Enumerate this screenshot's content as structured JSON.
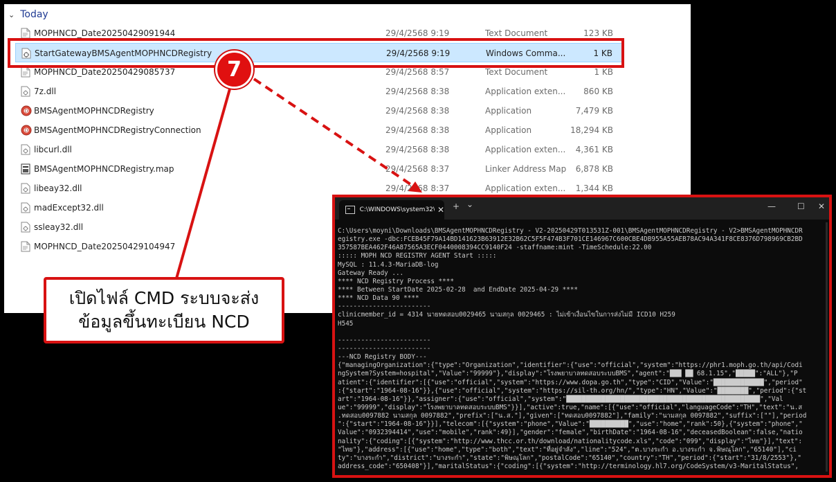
{
  "explorer": {
    "group_label": "Today",
    "files": [
      {
        "name": "MOPHNCD_Date20250429091944",
        "date": "29/4/2568 9:19",
        "type": "Text Document",
        "size": "123 KB",
        "icon": "text-file-icon",
        "selected": false
      },
      {
        "name": "StartGatewayBMSAgentMOPHNCDRegistry",
        "date": "29/4/2568 9:19",
        "type": "Windows Comma...",
        "size": "1 KB",
        "icon": "batch-file-icon",
        "selected": true
      },
      {
        "name": "MOPHNCD_Date20250429085737",
        "date": "29/4/2568 8:57",
        "type": "Text Document",
        "size": "1 KB",
        "icon": "text-file-icon",
        "selected": false
      },
      {
        "name": "7z.dll",
        "date": "29/4/2568 8:38",
        "type": "Application exten...",
        "size": "860 KB",
        "icon": "dll-file-icon",
        "selected": false
      },
      {
        "name": "BMSAgentMOPHNCDRegistry",
        "date": "29/4/2568 8:38",
        "type": "Application",
        "size": "7,479 KB",
        "icon": "app-icon",
        "selected": false
      },
      {
        "name": "BMSAgentMOPHNCDRegistryConnection",
        "date": "29/4/2568 8:38",
        "type": "Application",
        "size": "18,294 KB",
        "icon": "app-icon",
        "selected": false
      },
      {
        "name": "libcurl.dll",
        "date": "29/4/2568 8:38",
        "type": "Application exten...",
        "size": "4,361 KB",
        "icon": "dll-file-icon",
        "selected": false
      },
      {
        "name": "BMSAgentMOPHNCDRegistry.map",
        "date": "29/4/2568 8:37",
        "type": "Linker Address Map",
        "size": "6,878 KB",
        "icon": "map-file-icon",
        "selected": false
      },
      {
        "name": "libeay32.dll",
        "date": "29/4/2568 8:37",
        "type": "Application exten...",
        "size": "1,344 KB",
        "icon": "dll-file-icon",
        "selected": false
      },
      {
        "name": "madExcept32.dll",
        "date": "",
        "type": "",
        "size": "",
        "icon": "dll-file-icon",
        "selected": false
      },
      {
        "name": "ssleay32.dll",
        "date": "",
        "type": "",
        "size": "",
        "icon": "dll-file-icon",
        "selected": false
      },
      {
        "name": "MOPHNCD_Date20250429104947",
        "date": "",
        "type": "",
        "size": "",
        "icon": "text-file-icon",
        "selected": false
      }
    ]
  },
  "annotation": {
    "step_number": "7",
    "callout_line1": "เปิดไฟล์ CMD ระบบจะส่ง",
    "callout_line2": "ข้อมูลขึ้นทะเบียน NCD",
    "accent_color": "#d81212"
  },
  "cmd": {
    "tab_title": "C:\\WINDOWS\\system32\\cmd.",
    "new_tab": "+",
    "dropdown": "⌄",
    "minimize": "—",
    "maximize": "☐",
    "close": "✕",
    "lines": [
      "C:\\Users\\moyni\\Downloads\\BMSAgentMOPHNCDRegistry - V2-20250429T013531Z-001\\BMSAgentMOPHNCDRegistry - V2>BMSAgentMOPHNCDR",
      "egistry.exe -dbc:FCEB45F79A14BD141623B63912E32B62C5F5F474B3F701CE146967C600CBE4DB955A55AEB78AC94A341F8CE8376D798969CB2BD",
      "357587BEA462F46A87565A3ECF0440008394CC9140F24 -staffname:mint -TimeSchedule:22.00",
      "::::: MOPH NCD REGISTRY AGENT Start :::::",
      "MySQL : 11.4.3-MariaDB-log",
      "Gateway Ready ...",
      "**** NCD Registry Process ****",
      "**** Between StartDate 2025-02-28  and EndDate 2025-04-29 ****",
      "**** NCD Data 90 ****",
      "------------------------",
      "clinicmember_id = 4314 นายทดสอบ0029465 นามสกุล 0029465 : ไม่เข้าเงื่อนไขในการส่งไม่มี ICD10 H259",
      "H545",
      "",
      "------------------------",
      "------------------------",
      "---NCD Registry BODY---",
      "{\"managingOrganization\":{\"type\":\"Organization\",\"identifier\":{\"use\":\"official\",\"system\":\"https://phr1.moph.go.th/api/Codi",
      "ngSystem?System=hospital\",\"Value\":\"99999\"},\"display\":\"โรงพยาบาลทดสอบระบบBMS\",\"agent\":\"███ ██ 68.1.15\",\"█████\":\"ALL\"},\"P",
      "atient\":{\"identifier\":[{\"use\":\"official\",\"system\":\"https://www.dopa.go.th\",\"type\":\"CID\",\"Value\":\"█████████████\",\"period\"",
      ":{\"start\":\"1964-08-16\"}},{\"use\":\"official\",\"system\":\"https://sil-th.org/hn/\",\"type\":\"HN\",\"Value\":\"████████\",\"period\":{\"st",
      "art\":\"1964-08-16\"}},\"assigner\":{\"use\":\"official\",\"system\":\"██████████████████████████████████████████████████\",\"Val",
      "ue\":\"99999\",\"display\":\"โรงพยาบาลทดสอบระบบBMS\"}}],\"active\":true,\"name\":[{\"use\":\"official\",\"languageCode\":\"TH\",\"text\":\"น.ส",
      ".ทดสอบ0097882 นามสกุล 0097882\",\"prefix\":[\"น.ส.\"],\"given\":[\"ทดสอบ0097882\"],\"family\":\"นามสกุล 0097882\",\"suffix\":[\"\"],\"period",
      "\":{\"start\":\"1964-08-16\"}}],\"telecom\":[{\"system\":\"phone\",\"Value\":\"██████████\",\"use\":\"home\",\"rank\":50},{\"system\":\"phone\",\"",
      "Value\":\"0932394414\",\"use\":\"mobile\",\"rank\":49}],\"gender\":\"female\",\"birthDate\":\"1964-08-16\",\"deceasedBoolean\":false,\"natio",
      "nality\":{\"coding\":[{\"system\":\"http://www.thcc.or.th/download/nationalitycode.xls\",\"code\":\"099\",\"display\":\"ไทย\"}],\"text\":",
      "\"ไทย\"},\"address\":[{\"use\":\"home\",\"type\":\"both\",\"text\":\"ที่อยู่จำลัง\",\"line\":\"524\",\"ต.บางระกำ อ.บางระกำ จ.พิษณุโลก\",\"65140\"],\"ci",
      "ty\":\"บางระกำ\",\"district\":\"บางระกำ\",\"state\":\"พิษณุโลก\",\"postalCode\":\"65140\",\"country\":\"TH\",\"period\":{\"start\":\"31/8/2553\"},\"",
      "address_code\":\"650408\"}],\"maritalStatus\":{\"coding\":[{\"system\":\"http://terminology.hl7.org/CodeSystem/v3-MaritalStatus\","
    ]
  }
}
